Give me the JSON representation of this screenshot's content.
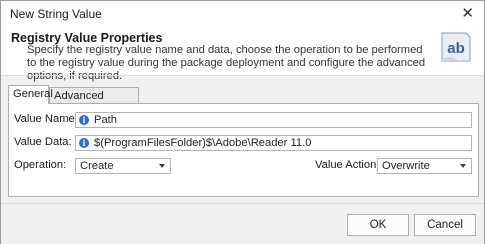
{
  "window": {
    "title": "New String Value",
    "close_glyph": "✕"
  },
  "header": {
    "title": "Registry Value Properties",
    "description": "Specify the registry value name and data, choose the operation to be performed to the registry value during the package deployment and configure the advanced options, if required.",
    "icon": "ab-text-icon",
    "icon_text": "ab"
  },
  "tabs": [
    {
      "label": "General",
      "active": true
    },
    {
      "label": "Advanced Options",
      "active": false
    }
  ],
  "form": {
    "value_name_label": "Value Name:",
    "value_name": "Path",
    "value_data_label": "Value Data:",
    "value_data": "$(ProgramFilesFolder)$\\Adobe\\Reader 11.0",
    "operation_label": "Operation:",
    "operation": "Create",
    "value_action_label": "Value Action:",
    "value_action": "Overwrite",
    "info_glyph": "i"
  },
  "footer": {
    "ok_label": "OK",
    "cancel_label": "Cancel"
  }
}
